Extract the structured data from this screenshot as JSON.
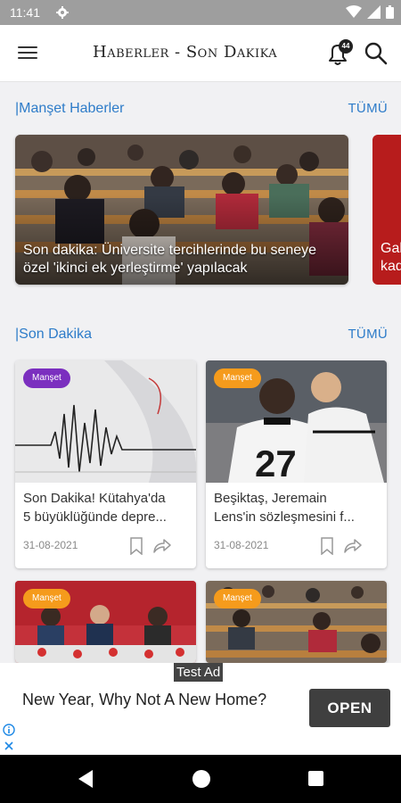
{
  "status_bar": {
    "time": "11:41"
  },
  "app_bar": {
    "title": "Haberler - Son Dakika",
    "notification_count": "44"
  },
  "headline_section": {
    "title": "|Manşet Haberler",
    "see_all": "TÜMÜ"
  },
  "headline": {
    "text": "Son dakika: Üniversite tercihlerinde bu seneye özel 'ikinci ek yerleştirme' yapılacak",
    "peek_text_line1": "Gal",
    "peek_text_line2": "kad"
  },
  "latest_section": {
    "title": "|Son Dakika",
    "see_all": "TÜMÜ"
  },
  "news": [
    {
      "badge": "Manşet",
      "line1": "Son Dakika! Kütahya'da",
      "line2": "5 büyüklüğünde depre...",
      "date": "31-08-2021"
    },
    {
      "badge": "Manşet",
      "line1": "Beşiktaş, Jeremain",
      "line2": "Lens'in sözleşmesini f...",
      "date": "31-08-2021"
    },
    {
      "badge": "Manşet"
    },
    {
      "badge": "Manşet"
    }
  ],
  "ad": {
    "label": "Test Ad",
    "text": "New Year, Why Not A New Home?",
    "cta": "OPEN"
  },
  "colors": {
    "accent": "#2e7cc9",
    "badge_purple": "#7b2fbf",
    "badge_orange": "#f59b1c",
    "status_bar": "#9e9e9e"
  },
  "icons": [
    "gear-icon",
    "wifi-icon",
    "signal-icon",
    "battery-icon",
    "menu-icon",
    "bell-icon",
    "search-icon",
    "bookmark-icon",
    "share-icon",
    "info-icon",
    "close-icon",
    "back-icon",
    "home-icon",
    "recents-icon"
  ]
}
